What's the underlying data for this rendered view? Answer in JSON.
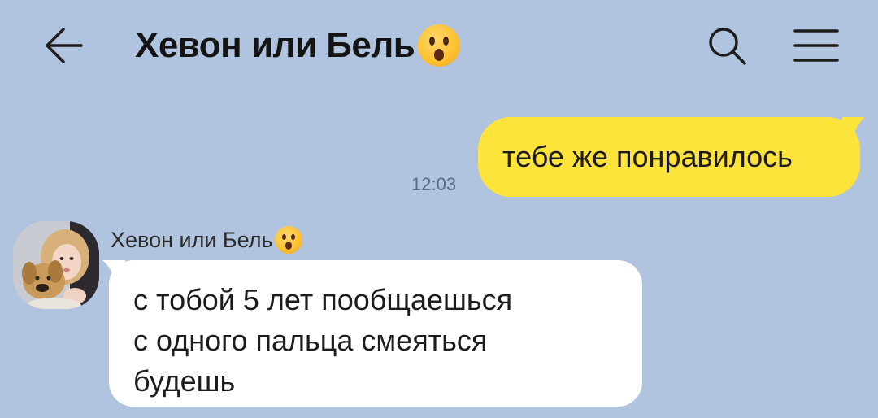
{
  "header": {
    "title": "Хевон или Бель",
    "title_emoji": "hushed-face-emoji",
    "back_icon": "arrow-left-icon",
    "search_icon": "search-icon",
    "menu_icon": "hamburger-menu-icon"
  },
  "messages": [
    {
      "direction": "outgoing",
      "text": "тебе же понравилось",
      "time": "12:03"
    },
    {
      "direction": "incoming",
      "sender": "Хевон или Бель",
      "sender_emoji": "hushed-face-emoji",
      "lines": [
        "с тобой 5 лет пообщаешься",
        "с одного пальца смеяться",
        "будешь"
      ]
    }
  ],
  "colors": {
    "background": "#b0c4df",
    "outgoing_bubble": "#fee33b",
    "incoming_bubble": "#ffffff",
    "text": "#1c1c1c",
    "time": "#5d6c80"
  }
}
